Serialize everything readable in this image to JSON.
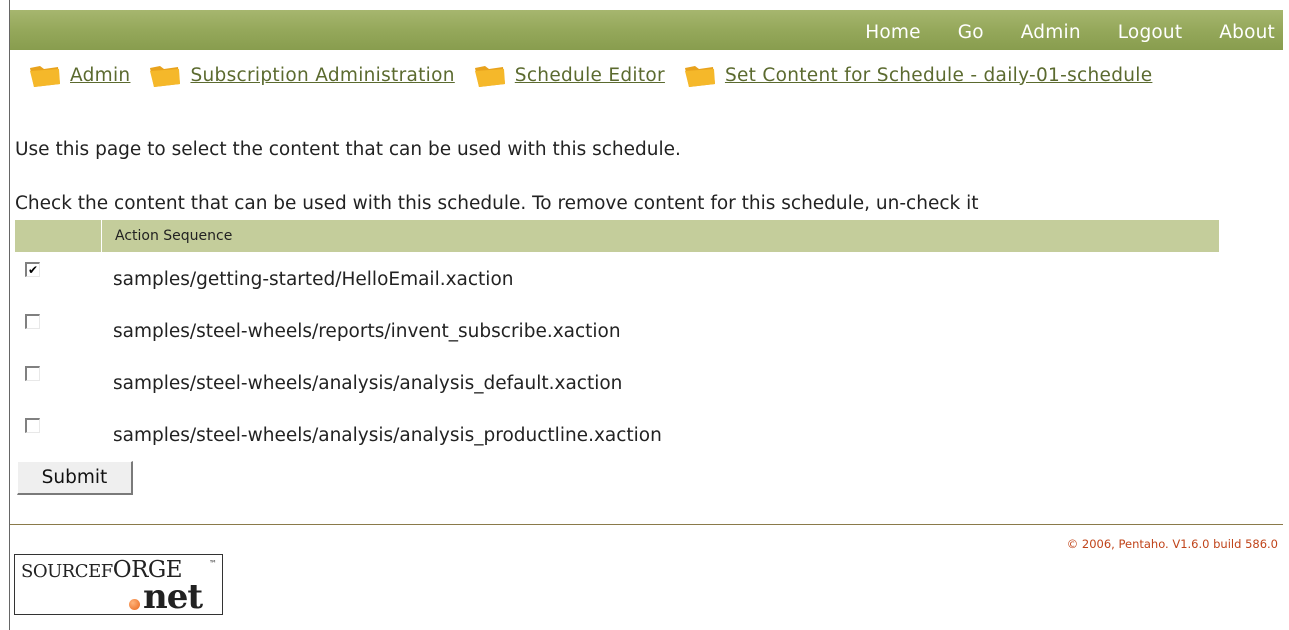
{
  "topnav": {
    "items": [
      "Home",
      "Go",
      "Admin",
      "Logout",
      "About"
    ]
  },
  "breadcrumb": {
    "items": [
      {
        "label": "Admin",
        "icon": "folder-icon"
      },
      {
        "label": "Subscription Administration",
        "icon": "folder-icon"
      },
      {
        "label": "Schedule Editor",
        "icon": "folder-icon"
      },
      {
        "label": "Set Content for Schedule - daily-01-schedule",
        "icon": "folder-icon"
      }
    ]
  },
  "intro_text": "Use this page to select the content that can be used with this schedule.",
  "instruction_text": "Check the content that can be used with this schedule. To remove content for this schedule, un-check it",
  "table": {
    "header": "Action Sequence",
    "rows": [
      {
        "label": "samples/getting-started/HelloEmail.xaction",
        "checked": true
      },
      {
        "label": "samples/steel-wheels/reports/invent_subscribe.xaction",
        "checked": false
      },
      {
        "label": "samples/steel-wheels/analysis/analysis_default.xaction",
        "checked": false
      },
      {
        "label": "samples/steel-wheels/analysis/analysis_productline.xaction",
        "checked": false
      }
    ]
  },
  "submit_label": "Submit",
  "footer": {
    "copyright": "© 2006, Pentaho. V1.6.0 build 586.0",
    "logo_text_source": "SOURCEF",
    "logo_text_o": "O",
    "logo_text_rge": "RGE",
    "logo_text_tm": "™",
    "logo_text_net": "net"
  },
  "colors": {
    "topbar": "#95a85b",
    "link": "#5b6a2f",
    "table_header": "#c4cd9b",
    "copyright": "#c0441a"
  }
}
